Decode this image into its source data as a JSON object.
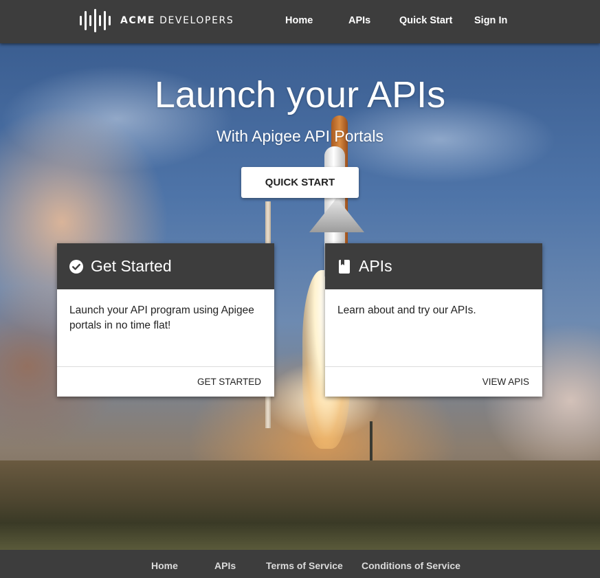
{
  "header": {
    "logo": {
      "brand": "ACME",
      "suffix": "DEVELOPERS",
      "icon": "sound-bars-logo-icon"
    },
    "nav": [
      "Home",
      "APIs",
      "Quick Start",
      "Sign In"
    ]
  },
  "hero": {
    "title": "Launch your APIs",
    "subtitle": "With Apigee API Portals",
    "cta_label": "QUICK START"
  },
  "cards": [
    {
      "title": "Get Started",
      "icon": "check-circle-icon",
      "body": "Launch your API program using Apigee portals in no time flat!",
      "action": "GET STARTED"
    },
    {
      "title": "APIs",
      "icon": "book-icon",
      "body": "Learn about and try our APIs.",
      "action": "VIEW APIS"
    }
  ],
  "footer": {
    "links": [
      "Home",
      "APIs",
      "Terms of Service",
      "Conditions of Service"
    ]
  },
  "colors": {
    "header_bg": "#3d3d3d",
    "card_head_bg": "#3d3d3d",
    "button_bg": "#ffffff",
    "text_light": "#ffffff"
  }
}
